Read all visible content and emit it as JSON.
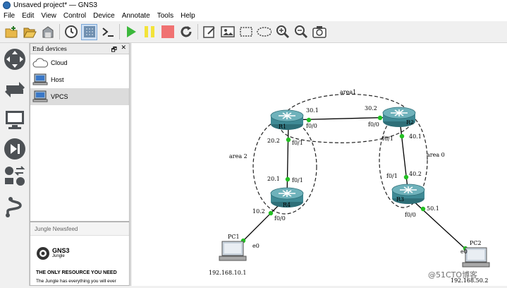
{
  "window": {
    "title": "Unsaved project* — GNS3"
  },
  "menu": [
    "File",
    "Edit",
    "View",
    "Control",
    "Device",
    "Annotate",
    "Tools",
    "Help"
  ],
  "toolbar": [
    {
      "icon": "new-project-icon"
    },
    {
      "icon": "open-project-icon"
    },
    {
      "icon": "save-project-icon"
    },
    {
      "icon": "snapshot-clock-icon"
    },
    {
      "icon": "show-interface-labels-icon"
    },
    {
      "icon": "console-all-icon"
    },
    {
      "icon": "start-all-icon"
    },
    {
      "icon": "suspend-all-icon"
    },
    {
      "icon": "stop-all-icon"
    },
    {
      "icon": "reload-all-icon"
    },
    {
      "icon": "add-note-icon"
    },
    {
      "icon": "insert-picture-icon"
    },
    {
      "icon": "draw-rectangle-icon"
    },
    {
      "icon": "draw-ellipse-icon"
    },
    {
      "icon": "zoom-in-icon"
    },
    {
      "icon": "zoom-out-icon"
    },
    {
      "icon": "screenshot-icon"
    }
  ],
  "sidebar": [
    {
      "icon": "routers-icon"
    },
    {
      "icon": "switches-icon"
    },
    {
      "icon": "end-devices-icon"
    },
    {
      "icon": "security-devices-icon"
    },
    {
      "icon": "all-devices-icon"
    },
    {
      "icon": "add-link-icon"
    }
  ],
  "dock": {
    "title": "End devices",
    "float_glyph": "🗗",
    "close_glyph": "✕",
    "devices": [
      {
        "label": "Cloud",
        "icon": "cloud-icon",
        "selected": false
      },
      {
        "label": "Host",
        "icon": "host-icon",
        "selected": false
      },
      {
        "label": "VPCS",
        "icon": "vpcs-icon",
        "selected": true
      }
    ]
  },
  "newsfeed": {
    "title": "Jungle Newsfeed",
    "brand": "GNS3",
    "brand_sub": "Jungle",
    "headline": "THE ONLY RESOURCE YOU NEED",
    "body": "The Jungle has everything you will ever"
  },
  "topology": {
    "areas": [
      "area1",
      "area 2",
      "area 0"
    ],
    "nodes": [
      "R1",
      "R2",
      "R3",
      "R4",
      "PC1",
      "PC2"
    ],
    "links": [
      {
        "a": "R1",
        "b": "R2",
        "a_port": "f0/0",
        "b_port": "f0/0",
        "a_addr": "30.1",
        "b_addr": "30.2"
      },
      {
        "a": "R1",
        "b": "R4",
        "a_port": "f0/1",
        "b_port": "f0/1",
        "a_addr": "20.2",
        "b_addr": "20.1"
      },
      {
        "a": "R2",
        "b": "R3",
        "a_port": "f0/1",
        "b_port": "f0/1",
        "a_addr": "40.1",
        "b_addr": "40.2"
      },
      {
        "a": "R4",
        "b": "PC1",
        "a_port": "f0/0",
        "b_port": "e0",
        "a_addr": "10.2",
        "b_addr": ""
      },
      {
        "a": "R3",
        "b": "PC2",
        "a_port": "f0/0",
        "b_port": "e0",
        "a_addr": "50.1",
        "b_addr": ""
      }
    ],
    "host_ips": {
      "PC1": "192.168.10.1",
      "PC2": "192.168.50.2"
    },
    "watermark": "@51CTO博客"
  },
  "colors": {
    "router": "#3f8a95",
    "link_dot": "#22c022",
    "title_icon": "#2f6fb3"
  }
}
